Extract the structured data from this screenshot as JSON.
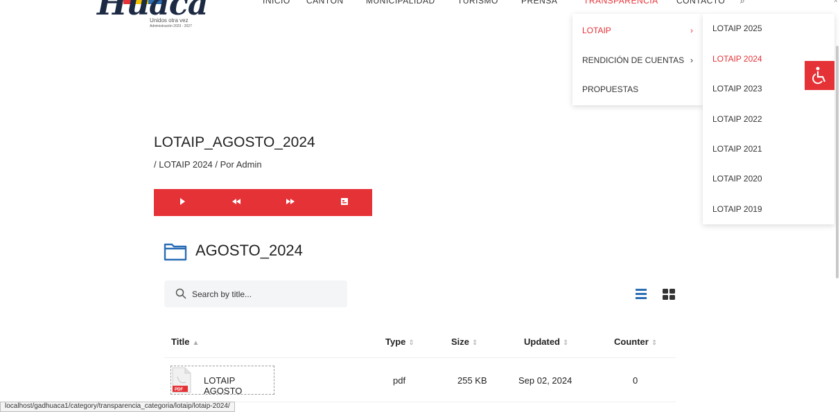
{
  "nav": {
    "items": [
      "INICIO",
      "CANTÓN",
      "MUNICIPALIDAD",
      "TURISMO",
      "PRENSA",
      "TRANSPARENCIA",
      "CONTACTO"
    ],
    "active_index": 5
  },
  "logo": {
    "wordmark": "Huaca",
    "tagline": "Unidos otra vez",
    "admin": "Administración 2023 - 2027"
  },
  "dropdown": {
    "items": [
      {
        "label": "LOTAIP",
        "has_submenu": true
      },
      {
        "label": "RENDICIÓN DE CUENTAS",
        "has_submenu": true
      },
      {
        "label": "PROPUESTAS",
        "has_submenu": false
      }
    ],
    "active_index": 0,
    "arrow": "›"
  },
  "submenu": {
    "items": [
      "LOTAIP 2025",
      "LOTAIP 2024",
      "LOTAIP 2023",
      "LOTAIP 2022",
      "LOTAIP 2021",
      "LOTAIP 2020",
      "LOTAIP 2019"
    ],
    "active_index": 1
  },
  "post": {
    "title": "LOTAIP_AGOSTO_2024",
    "meta": "/ LOTAIP 2024 / Por Admin"
  },
  "player": {
    "icons": [
      "play-icon",
      "rewind-icon",
      "fast-forward-icon",
      "playlist-icon"
    ]
  },
  "folder": {
    "name": "AGOSTO_2024"
  },
  "search": {
    "placeholder": "Search by title..."
  },
  "table": {
    "columns": [
      "Title",
      "Type",
      "Size",
      "Updated",
      "Counter"
    ],
    "sort_glyphs": {
      "asc": "▲",
      "both": "⇕"
    },
    "rows": [
      {
        "title": "LOTAIP AGOSTO",
        "badge": "PDF",
        "type": "pdf",
        "size": "255 KB",
        "updated": "Sep 02, 2024",
        "counter": "0"
      }
    ]
  },
  "status_url": "localhost/gadhuaca1/category/transparencia_categoria/lotaip/lotaip-2024/",
  "colors": {
    "accent": "#e53237",
    "folder_blue": "#2a6db5",
    "brand_navy": "#1d2a44"
  }
}
